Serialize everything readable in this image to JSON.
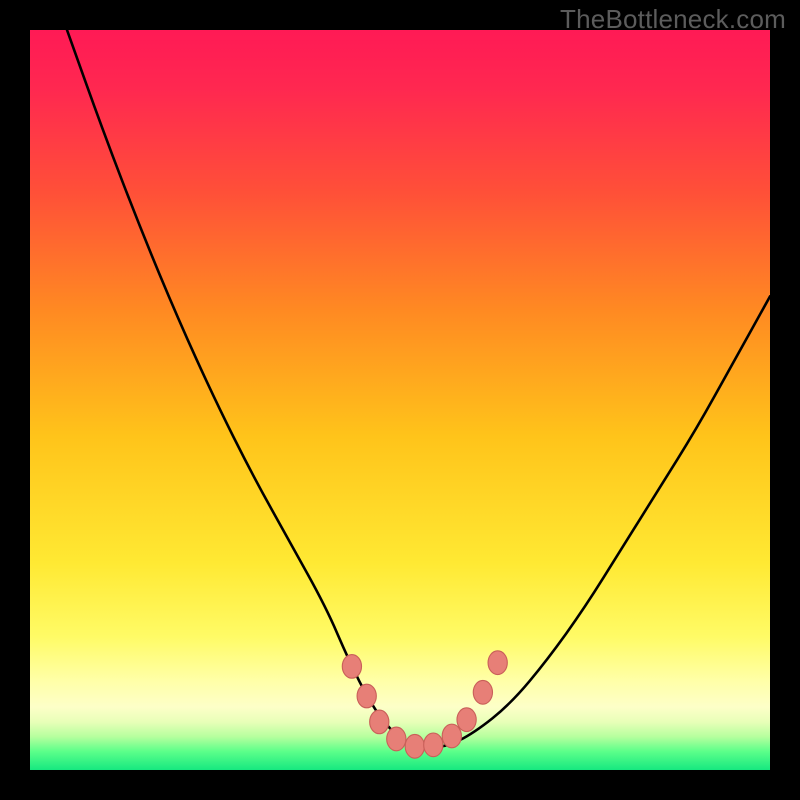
{
  "watermark": "TheBottleneck.com",
  "colors": {
    "frame": "#000000",
    "curve": "#000000",
    "marker_fill": "#e77f77",
    "marker_stroke": "#c95f59",
    "gradient_stops": [
      {
        "offset": 0.0,
        "color": "#ff1a55"
      },
      {
        "offset": 0.08,
        "color": "#ff2850"
      },
      {
        "offset": 0.22,
        "color": "#ff5038"
      },
      {
        "offset": 0.38,
        "color": "#ff8a22"
      },
      {
        "offset": 0.55,
        "color": "#ffc41a"
      },
      {
        "offset": 0.72,
        "color": "#ffe933"
      },
      {
        "offset": 0.82,
        "color": "#fffb66"
      },
      {
        "offset": 0.88,
        "color": "#ffffa8"
      },
      {
        "offset": 0.915,
        "color": "#fdffc8"
      },
      {
        "offset": 0.935,
        "color": "#e8ffb8"
      },
      {
        "offset": 0.955,
        "color": "#b6ff9e"
      },
      {
        "offset": 0.975,
        "color": "#5cff8a"
      },
      {
        "offset": 1.0,
        "color": "#16e880"
      }
    ]
  },
  "chart_data": {
    "type": "line",
    "title": "",
    "xlabel": "",
    "ylabel": "",
    "xlim": [
      0,
      100
    ],
    "ylim": [
      0,
      100
    ],
    "series": [
      {
        "name": "bottleneck-curve",
        "x": [
          5,
          10,
          15,
          20,
          25,
          30,
          35,
          40,
          43,
          46,
          49,
          52,
          56,
          60,
          65,
          70,
          75,
          80,
          85,
          90,
          95,
          100
        ],
        "y": [
          100,
          86,
          73,
          61,
          50,
          40,
          31,
          22,
          15,
          9,
          5,
          3,
          3,
          5,
          9,
          15,
          22,
          30,
          38,
          46,
          55,
          64
        ]
      }
    ],
    "markers": {
      "name": "highlight-points",
      "x": [
        43.5,
        45.5,
        47.2,
        49.5,
        52.0,
        54.5,
        57.0,
        59.0,
        61.2,
        63.2
      ],
      "y": [
        14.0,
        10.0,
        6.5,
        4.2,
        3.2,
        3.4,
        4.6,
        6.8,
        10.5,
        14.5
      ]
    }
  }
}
